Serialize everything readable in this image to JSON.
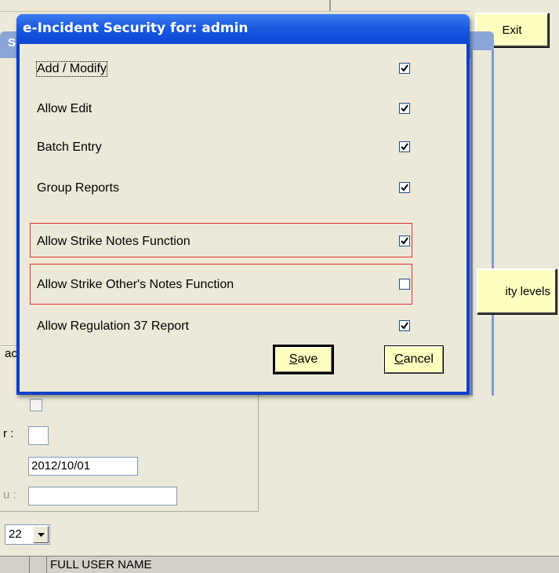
{
  "background_app": {
    "exit_label": "Exit",
    "security_button_label": "ity levels",
    "checkbox_row_label_fragment": "ac",
    "field_label_1": "r :",
    "date_value": "2012/10/01",
    "field_label_3": "u :",
    "combo_value": "22",
    "grid_header": "FULL USER NAME",
    "blue_panel_letter": "S"
  },
  "dialog": {
    "title": "e-Incident Security for: admin",
    "permissions": [
      {
        "label": "Add / Modify",
        "checked": true,
        "highlighted": false
      },
      {
        "label": "Allow Edit",
        "checked": true,
        "highlighted": false
      },
      {
        "label": "Batch Entry",
        "checked": true,
        "highlighted": false
      },
      {
        "label": "Group Reports",
        "checked": true,
        "highlighted": false
      },
      {
        "label": "Allow Strike Notes Function",
        "checked": true,
        "highlighted": true
      },
      {
        "label": "Allow Strike Other's Notes Function",
        "checked": false,
        "highlighted": true
      },
      {
        "label": "Allow Regulation 37 Report",
        "checked": true,
        "highlighted": false
      }
    ],
    "save_label": "Save",
    "cancel_label": "Cancel"
  },
  "colors": {
    "title_bar": "#1a5ae0",
    "button_face": "#ffffc0",
    "highlight_border": "#e03030",
    "dialog_face": "#ece9d8"
  }
}
